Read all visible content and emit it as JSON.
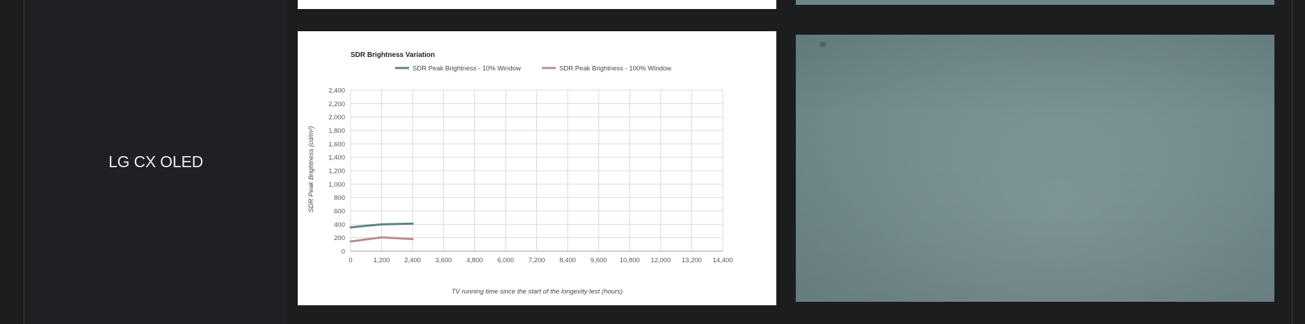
{
  "row": {
    "tv_name": "LG CX OLED"
  },
  "colors": {
    "page_background": "#1c1d1f",
    "label_cell": "#1f2023",
    "photo_tint": "#7a9294"
  },
  "chart_data": {
    "type": "line",
    "title": "SDR Brightness Variation",
    "xlabel": "TV running time since the start of the longevity test (hours)",
    "ylabel": "SDR Peak Brightness (cd/m²)",
    "xlim": [
      0,
      14400
    ],
    "ylim": [
      0,
      2400
    ],
    "x_ticks": [
      "0",
      "1,200",
      "2,400",
      "3,600",
      "4,800",
      "6,000",
      "7,200",
      "8,400",
      "9,600",
      "10,800",
      "12,000",
      "13,200",
      "14,400"
    ],
    "y_ticks": [
      "2,400",
      "2,200",
      "2,000",
      "1,800",
      "1,600",
      "1,400",
      "1,200",
      "1,000",
      "800",
      "600",
      "400",
      "200",
      "0"
    ],
    "grid": true,
    "legend_position": "top",
    "series": [
      {
        "name": "SDR Peak Brightness - 10% Window",
        "color": "#5f7f86",
        "x": [
          0,
          1200,
          2400
        ],
        "y": [
          355,
          400,
          410
        ]
      },
      {
        "name": "SDR Peak Brightness - 100% Window",
        "color": "#b88a8f",
        "x": [
          0,
          1200,
          2400
        ],
        "y": [
          145,
          205,
          180
        ]
      }
    ]
  }
}
